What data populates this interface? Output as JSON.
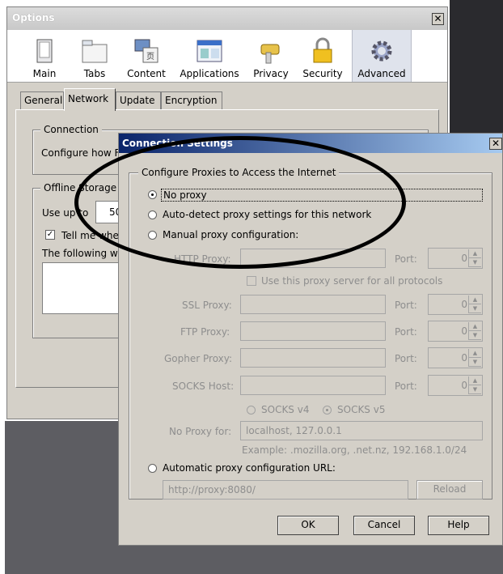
{
  "options": {
    "title": "Options",
    "close": "✕",
    "toolbar": [
      "Main",
      "Tabs",
      "Content",
      "Applications",
      "Privacy",
      "Security",
      "Advanced"
    ],
    "tabs": [
      "General",
      "Network",
      "Update",
      "Encryption"
    ],
    "connection_legend": "Connection",
    "connection_text": "Configure how Fi",
    "offline_legend": "Offline Storage",
    "use_up_label": "Use up to",
    "use_up_value": "50",
    "tell_me_label": "Tell me when",
    "following_label": "The following we"
  },
  "dialog": {
    "title": "Connection Settings",
    "close": "✕",
    "group_legend": "Configure Proxies to Access the Internet",
    "no_proxy": "No proxy",
    "auto_detect": "Auto-detect proxy settings for this network",
    "manual": "Manual proxy configuration:",
    "http_label": "HTTP Proxy:",
    "use_same": "Use this proxy server for all protocols",
    "ssl_label": "SSL Proxy:",
    "ftp_label": "FTP Proxy:",
    "gopher_label": "Gopher Proxy:",
    "socks_label": "SOCKS Host:",
    "port_label": "Port:",
    "port_value": "0",
    "socks_v4": "SOCKS v4",
    "socks_v5": "SOCKS v5",
    "no_proxy_for_label": "No Proxy for:",
    "no_proxy_for_value": "localhost, 127.0.0.1",
    "example": "Example: .mozilla.org, .net.nz, 192.168.1.0/24",
    "auto_config": "Automatic proxy configuration URL:",
    "auto_url_placeholder": "http://proxy:8080/",
    "reload": "Reload",
    "ok": "OK",
    "cancel": "Cancel",
    "help": "Help"
  }
}
